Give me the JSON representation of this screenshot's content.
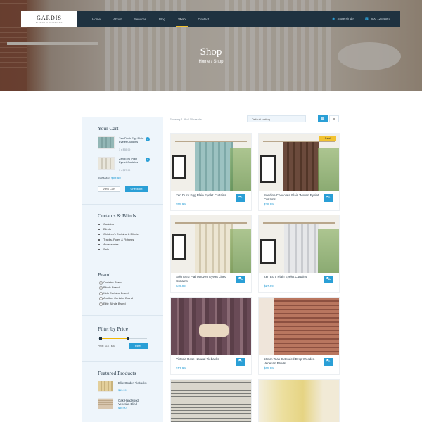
{
  "header": {
    "logo_name": "GARDIS",
    "logo_tagline": "BLINDS & CURTAINS",
    "nav": [
      "Home",
      "About",
      "Services",
      "Blog",
      "Shop",
      "Contact"
    ],
    "active_nav": "Shop",
    "store_finder": "Store Finder",
    "phone": "800 123 4567"
  },
  "hero": {
    "title": "Shop",
    "breadcrumb": "Home / Shop"
  },
  "cart": {
    "title": "Your Cart",
    "items": [
      {
        "name": "Zen Duck Egg Plain Eyelet Curtains",
        "qty": "1 x $55.99"
      },
      {
        "name": "Zen Ecru Plain Eyelet Curtains",
        "qty": "1 x $27.99"
      }
    ],
    "subtotal_label": "Subtotal:",
    "subtotal_value": "$83.98",
    "view_cart": "View Cart",
    "checkout": "Checkout"
  },
  "categories": {
    "title": "Curtains & Blinds",
    "items": [
      "Curtains",
      "Blinds",
      "Children's Curtains & Blinds",
      "Tracks, Poles & Fixtures",
      "Accessories",
      "Sale"
    ]
  },
  "brand": {
    "title": "Brand",
    "items": [
      "Curtains Brand",
      "Blinds Brand",
      "Kids Curtains Brand",
      "Another Curtains Brand",
      "Elite Blinds Brand"
    ]
  },
  "filter": {
    "title": "Filter by Price",
    "range": "Price: $13 - $80",
    "button": "Filter",
    "min_frac": 0.05,
    "max_frac": 0.62
  },
  "featured": {
    "title": "Featured Products",
    "items": [
      {
        "name": "Elite Golden Tiebacks",
        "price": "$13.99"
      },
      {
        "name": "Oak Handwood Venetian Blind",
        "price": "$80.00"
      }
    ]
  },
  "toolbar": {
    "showing": "Showing 1–8 of 10 results",
    "sort": "Default sorting",
    "grid_icon": "grid-icon",
    "list_icon": "list-icon"
  },
  "products": [
    {
      "name": "Zen Duck Egg Plain Eyelet Curtains",
      "price": "$55.99",
      "sale": ""
    },
    {
      "name": "Suedine Chocolate Plain Woven Eyelet Curtains",
      "price": "$38.99",
      "sale": "Sale!"
    },
    {
      "name": "Solo Ecru Plain Woven Eyelet Lined Curtains",
      "price": "$49.99",
      "sale": ""
    },
    {
      "name": "Zen Ecru Plain Eyelet Curtains",
      "price": "$27.99",
      "sale": ""
    },
    {
      "name": "Victoria Rose Natural Tiebacks",
      "price": "$13.99",
      "sale": ""
    },
    {
      "name": "50mm Teak Extended Drop Wooden Venetian Blinds",
      "price": "$65.99",
      "sale": ""
    },
    {
      "name": "",
      "price": "",
      "sale": ""
    },
    {
      "name": "",
      "price": "",
      "sale": ""
    }
  ],
  "colors": {
    "accent": "#2a9fd6",
    "nav_bg": "#1f3240",
    "sale": "#f2c230",
    "sidebar_bg": "#eef5fb"
  }
}
